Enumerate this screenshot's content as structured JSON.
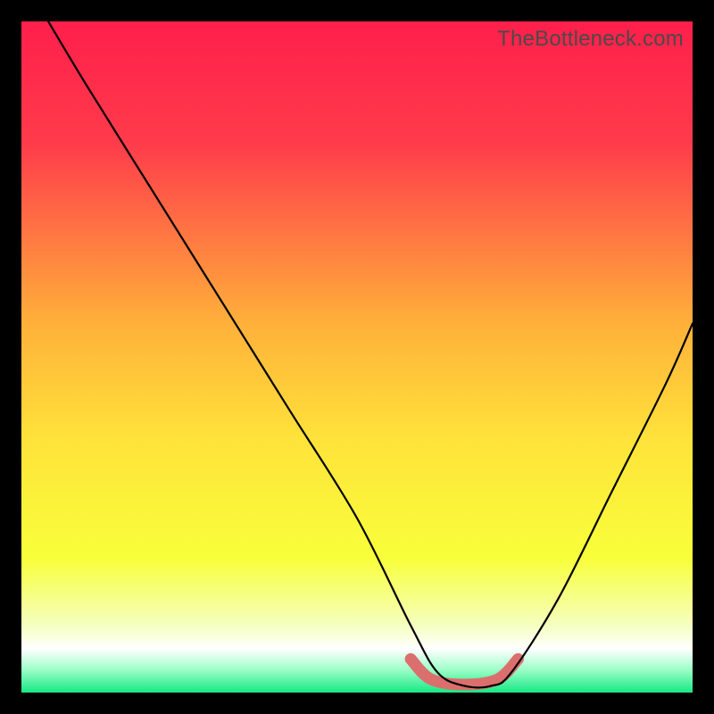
{
  "watermark": "TheBottleneck.com",
  "chart_data": {
    "type": "line",
    "title": "",
    "xlabel": "",
    "ylabel": "",
    "xlim": [
      0,
      100
    ],
    "ylim": [
      0,
      100
    ],
    "gradient_stops": [
      {
        "offset": 0.0,
        "color": "#ff1f4b"
      },
      {
        "offset": 0.18,
        "color": "#ff3b4b"
      },
      {
        "offset": 0.45,
        "color": "#ffb03a"
      },
      {
        "offset": 0.62,
        "color": "#ffe23a"
      },
      {
        "offset": 0.8,
        "color": "#f8ff3a"
      },
      {
        "offset": 0.9,
        "color": "#f5ffc0"
      },
      {
        "offset": 0.935,
        "color": "#ffffff"
      },
      {
        "offset": 0.965,
        "color": "#9fffc9"
      },
      {
        "offset": 1.0,
        "color": "#17e884"
      }
    ],
    "series": [
      {
        "name": "bottleneck-curve",
        "color": "#000000",
        "x": [
          4,
          10,
          20,
          30,
          40,
          50,
          58,
          62,
          66,
          70,
          73,
          80,
          88,
          96,
          100
        ],
        "y": [
          100,
          90,
          74,
          58,
          42,
          26,
          10,
          3,
          1,
          1,
          3,
          14,
          30,
          46,
          55
        ]
      }
    ],
    "highlight_band": {
      "color": "#db6f6d",
      "x": [
        58,
        61,
        66,
        71,
        74
      ],
      "y": [
        5,
        2,
        1.2,
        2,
        5
      ]
    }
  }
}
